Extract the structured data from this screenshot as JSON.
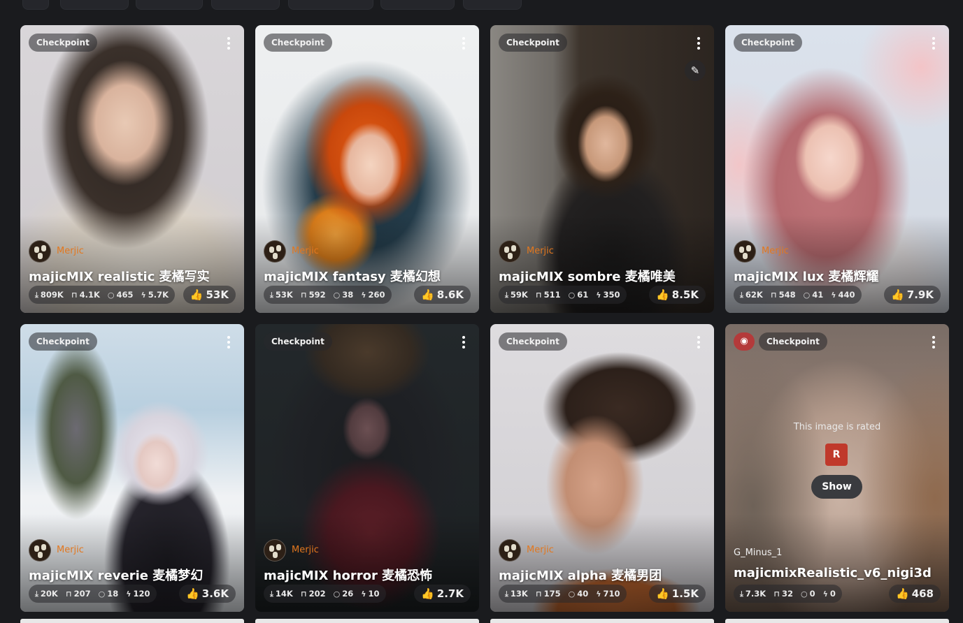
{
  "cards": [
    {
      "badge": "Checkpoint",
      "creator": "Merjic",
      "title": "majicMIX realistic 麦橘写实",
      "stats": {
        "downloads": "809K",
        "favorites": "4.1K",
        "comments": "465",
        "tips": "5.7K"
      },
      "likes": "53K",
      "colors": {
        "accent": "#e2771e"
      }
    },
    {
      "badge": "Checkpoint",
      "creator": "Merjic",
      "title": "majicMIX fantasy 麦橘幻想",
      "stats": {
        "downloads": "53K",
        "favorites": "592",
        "comments": "38",
        "tips": "260"
      },
      "likes": "8.6K"
    },
    {
      "badge": "Checkpoint",
      "creator": "Merjic",
      "title": "majicMIX sombre 麦橘唯美",
      "stats": {
        "downloads": "59K",
        "favorites": "511",
        "comments": "61",
        "tips": "350"
      },
      "likes": "8.5K"
    },
    {
      "badge": "Checkpoint",
      "creator": "Merjic",
      "title": "majicMIX lux 麦橘辉耀",
      "stats": {
        "downloads": "62K",
        "favorites": "548",
        "comments": "41",
        "tips": "440"
      },
      "likes": "7.9K"
    },
    {
      "badge": "Checkpoint",
      "creator": "Merjic",
      "title": "majicMIX reverie 麦橘梦幻",
      "stats": {
        "downloads": "20K",
        "favorites": "207",
        "comments": "18",
        "tips": "120"
      },
      "likes": "3.6K"
    },
    {
      "badge": "Checkpoint",
      "creator": "Merjic",
      "title": "majicMIX horror 麦橘恐怖",
      "stats": {
        "downloads": "14K",
        "favorites": "202",
        "comments": "26",
        "tips": "10"
      },
      "likes": "2.7K"
    },
    {
      "badge": "Checkpoint",
      "creator": "Merjic",
      "title": "majicMIX alpha 麦橘男团",
      "stats": {
        "downloads": "13K",
        "favorites": "175",
        "comments": "40",
        "tips": "710"
      },
      "likes": "1.5K"
    },
    {
      "badge": "Checkpoint",
      "creator": "G_Minus_1",
      "title": "majicmixRealistic_v6_nigi3d",
      "stats": {
        "downloads": "7.3K",
        "favorites": "32",
        "comments": "0",
        "tips": "0"
      },
      "likes": "468",
      "nsfw": {
        "message": "This image is rated",
        "rating": "R",
        "show_label": "Show"
      }
    }
  ],
  "icons": {
    "download": "download-icon",
    "favorite": "bookmark-icon",
    "comment": "comment-icon",
    "tip": "bolt-icon",
    "like": "thumb-up-icon",
    "menu": "kebab-menu-icon",
    "remix": "brush-icon",
    "hide": "eye-icon"
  },
  "colors": {
    "background": "#1a1b1e",
    "creator_name": "#e2771e",
    "like_icon": "#f59f00",
    "rating_badge": "#c0392b",
    "eye_button": "#b43a3a"
  }
}
